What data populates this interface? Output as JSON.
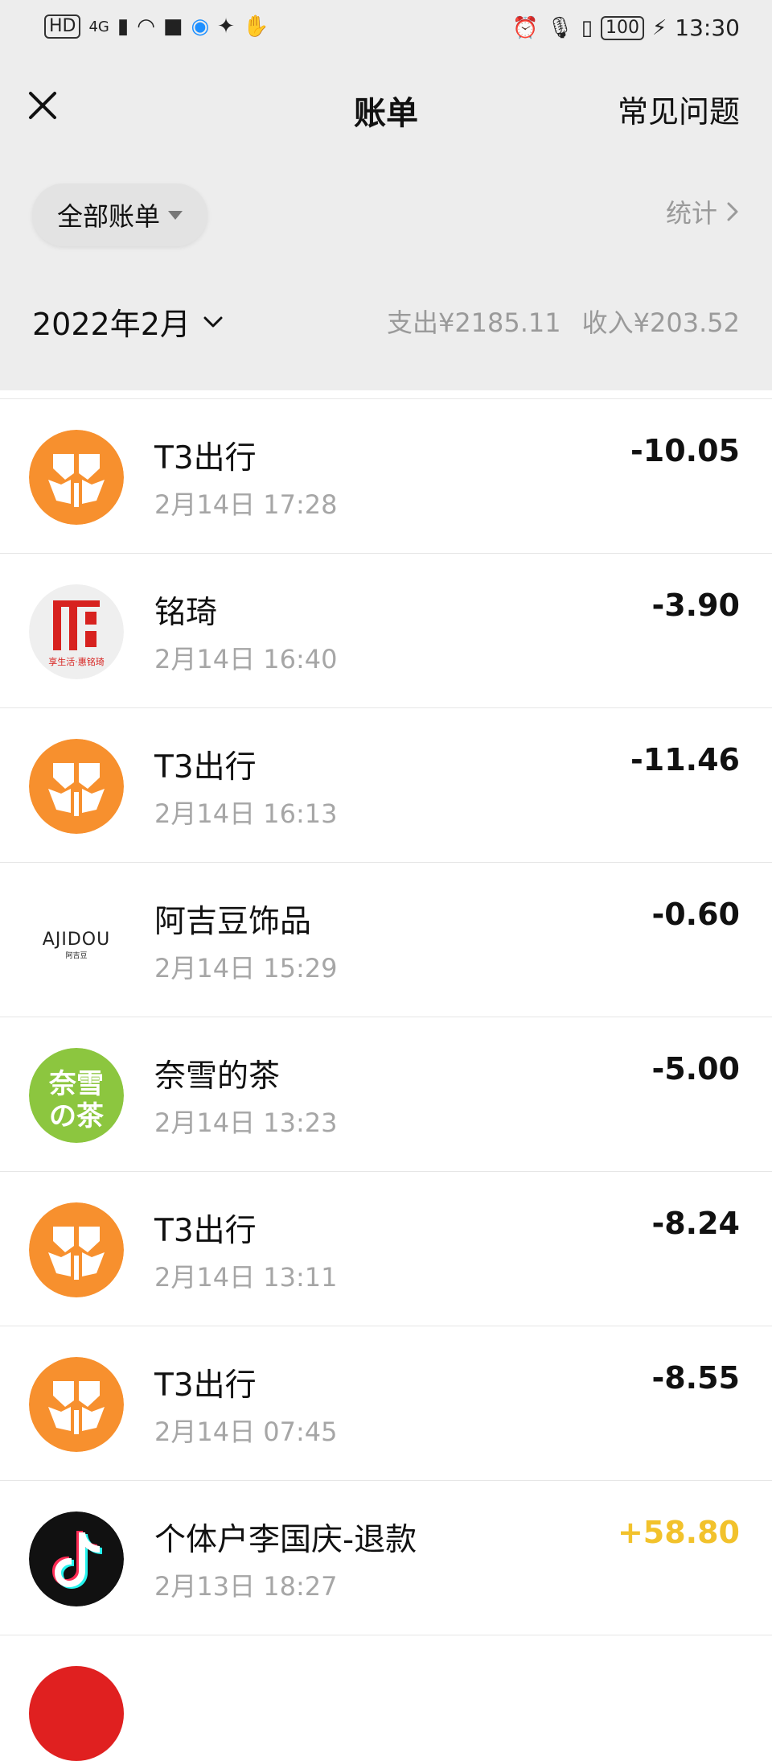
{
  "status": {
    "hd": "HD",
    "network": "4G",
    "battery": "100",
    "time": "13:30"
  },
  "nav": {
    "title": "账单",
    "faq": "常见问题"
  },
  "filter": {
    "label": "全部账单",
    "stats": "统计"
  },
  "summary": {
    "month": "2022年2月",
    "expense": "支出¥2185.11",
    "income": "收入¥203.52"
  },
  "colors": {
    "income": "#f2c22c",
    "t3_orange": "#f7902e",
    "nayuki_green": "#8cc63f",
    "mingqi_red": "#d7221f",
    "tiktok_bg": "#111111"
  },
  "transactions": [
    {
      "merchant": "T3出行",
      "time": "2月14日 17:28",
      "amount": "-10.05",
      "icon": "t3-logo-icon"
    },
    {
      "merchant": "铭琦",
      "time": "2月14日 16:40",
      "amount": "-3.90",
      "icon": "mingqi-logo-icon",
      "logo_text": "享生活·惠铭琦"
    },
    {
      "merchant": "T3出行",
      "time": "2月14日 16:13",
      "amount": "-11.46",
      "icon": "t3-logo-icon"
    },
    {
      "merchant": "阿吉豆饰品",
      "time": "2月14日 15:29",
      "amount": "-0.60",
      "icon": "ajidou-logo-icon",
      "logo_text": "AJIDOU",
      "logo_subtext": "阿吉豆"
    },
    {
      "merchant": "奈雪的茶",
      "time": "2月14日 13:23",
      "amount": "-5.00",
      "icon": "nayuki-logo-icon",
      "logo_text": "奈雪の茶"
    },
    {
      "merchant": "T3出行",
      "time": "2月14日 13:11",
      "amount": "-8.24",
      "icon": "t3-logo-icon"
    },
    {
      "merchant": "T3出行",
      "time": "2月14日 07:45",
      "amount": "-8.55",
      "icon": "t3-logo-icon"
    },
    {
      "merchant": "个体户李国庆-退款",
      "time": "2月13日 18:27",
      "amount": "+58.80",
      "icon": "tiktok-logo-icon"
    }
  ]
}
